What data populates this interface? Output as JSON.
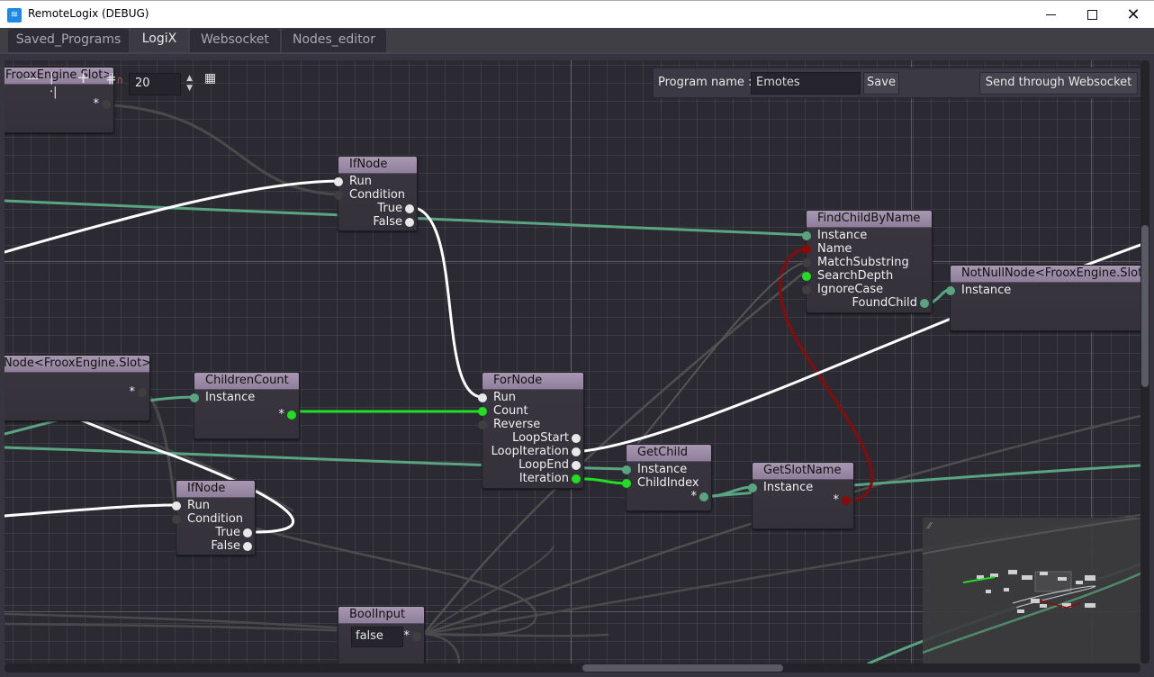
{
  "window": {
    "title": "RemoteLogix (DEBUG)",
    "icon": "wifi-icon",
    "controls": [
      "minimize",
      "maximize",
      "close"
    ]
  },
  "tabs": [
    {
      "label": "Saved_Programs",
      "active": false
    },
    {
      "label": "LogiX",
      "active": true
    },
    {
      "label": "Websocket",
      "active": false
    },
    {
      "label": "Nodes_editor",
      "active": false
    }
  ],
  "toolbar": {
    "zoom_out_icon": "minus-icon",
    "zoom_reset_icon": "reset-zoom-icon",
    "zoom_in_icon": "plus-icon",
    "snap_icon": "snap-icon",
    "snap_value": "20",
    "minimap_icon": "grid-map-icon"
  },
  "program_bar": {
    "label": "Program name :",
    "value": "Emotes",
    "save_label": "Save",
    "send_label": "Send through Websocket"
  },
  "nodes": {
    "slot_top": {
      "title": "FrooxEngine.Slot>",
      "outputs": [
        "*"
      ]
    },
    "ifnode_1": {
      "title": "IfNode",
      "inputs": [
        "Run",
        "Condition"
      ],
      "outputs": [
        "True",
        "False"
      ]
    },
    "findchild": {
      "title": "FindChildByName",
      "inputs": [
        "Instance",
        "Name",
        "MatchSubstring",
        "SearchDepth",
        "IgnoreCase"
      ],
      "outputs": [
        "FoundChild"
      ]
    },
    "notnull": {
      "title": "NotNullNode<FrooxEngine.Slot",
      "inputs": [
        "Instance"
      ]
    },
    "slot_mid": {
      "title": "Node<FrooxEngine.Slot>",
      "outputs": [
        "*"
      ]
    },
    "childrencount": {
      "title": "ChildrenCount",
      "inputs": [
        "Instance"
      ],
      "outputs": [
        "*"
      ]
    },
    "fornode": {
      "title": "ForNode",
      "inputs": [
        "Run",
        "Count",
        "Reverse"
      ],
      "outputs": [
        "LoopStart",
        "LoopIteration",
        "LoopEnd",
        "Iteration"
      ]
    },
    "getchild": {
      "title": "GetChild",
      "inputs": [
        "Instance",
        "ChildIndex"
      ],
      "outputs": [
        "*"
      ]
    },
    "getslotname": {
      "title": "GetSlotName",
      "inputs": [
        "Instance"
      ],
      "outputs": [
        "*"
      ]
    },
    "ifnode_2": {
      "title": "IfNode",
      "inputs": [
        "Run",
        "Condition"
      ],
      "outputs": [
        "True",
        "False"
      ]
    },
    "boolinput": {
      "title": "BoolInput",
      "value": "false",
      "outputs": [
        "*"
      ]
    }
  },
  "colors": {
    "impulse": "#ffffff",
    "int": "#22dd22",
    "slot": "#5aa581",
    "string": "#8a0a0a",
    "bool": "#4a4a4a",
    "node_header": "#9d8daa",
    "canvas_bg": "#2b2a33"
  }
}
